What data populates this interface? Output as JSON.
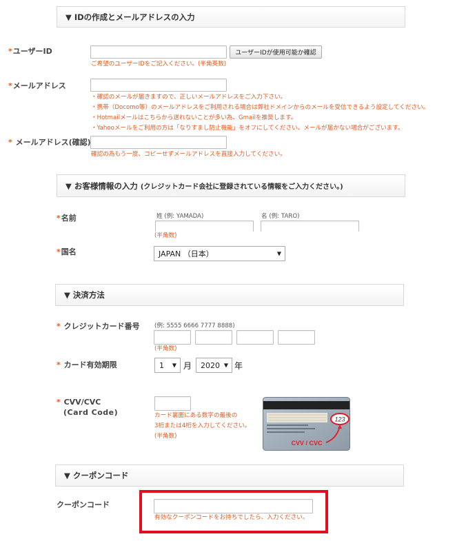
{
  "sections": {
    "id_email": {
      "title": "▼ IDの作成とメールアドレスの入力"
    },
    "customer": {
      "title": "▼ お客様情報の入力",
      "subtitle": "(クレジットカード会社に登録されている情報をご入力ください。)"
    },
    "payment": {
      "title": "▼ 決済方法"
    },
    "coupon": {
      "title": "▼ クーポンコード"
    }
  },
  "user_id": {
    "required_mark": "*",
    "label": "ユーザーID",
    "value": "",
    "check_button": "ユーザーIDが使用可能か確認",
    "note": "ご希望のユーザーIDをご記入ください。(半角英数)"
  },
  "email": {
    "required_mark": "*",
    "label": "メールアドレス",
    "value": "",
    "notes": [
      "・確認のメールが届きますので、正しいメールアドレスをご入力下さい。",
      "・携帯（Docomo等）のメールアドレスをご利用される場合は弊社ドメインからのメールを受信できるよう設定してください。",
      "・Hotmailメールはこちらから送れないことが多い為、Gmailを推奨します。",
      "・Yahooメールをご利用の方は「なりすまし防止機能」をオフにしてください。メールが届かない場合がございます。"
    ]
  },
  "email_confirm": {
    "required_mark": "*",
    "label": " メールアドレス(確認)",
    "value": "",
    "note": "確認の為もう一度、コピーせずメールアドレスを直接入力してください。"
  },
  "name": {
    "required_mark": "*",
    "label": "名前",
    "last_hint": "姓 (例: YAMADA)",
    "first_hint": "名 (例: TARO)",
    "note": "(半角数)"
  },
  "country": {
    "required_mark": "*",
    "label": "国名",
    "selected": "JAPAN （日本）"
  },
  "card_number": {
    "required_mark": "*",
    "label": " クレジットカード番号",
    "hint": "(例: 5555 6666 7777 8888)",
    "note": "(半角数)"
  },
  "expiry": {
    "required_mark": "*",
    "label": " カード有効期限",
    "month": "1",
    "month_unit": "月",
    "year": "2020",
    "year_unit": "年"
  },
  "cvv": {
    "required_mark": "*",
    "label": " CVV/CVC",
    "label2": "(Card Code)",
    "notes": [
      "カード裏面にある数字の最後の",
      "3桁または4桁を入力してください。",
      "(半角数)"
    ],
    "card_number_text": "123",
    "card_caption": "CVV / CVC"
  },
  "coupon_field": {
    "label": "クーポンコード",
    "value": "",
    "note": "有効なクーポンコードをお持ちでしたら、入力ください。"
  },
  "colors": {
    "accent": "#e25b23",
    "highlight_box": "#e0101e"
  }
}
